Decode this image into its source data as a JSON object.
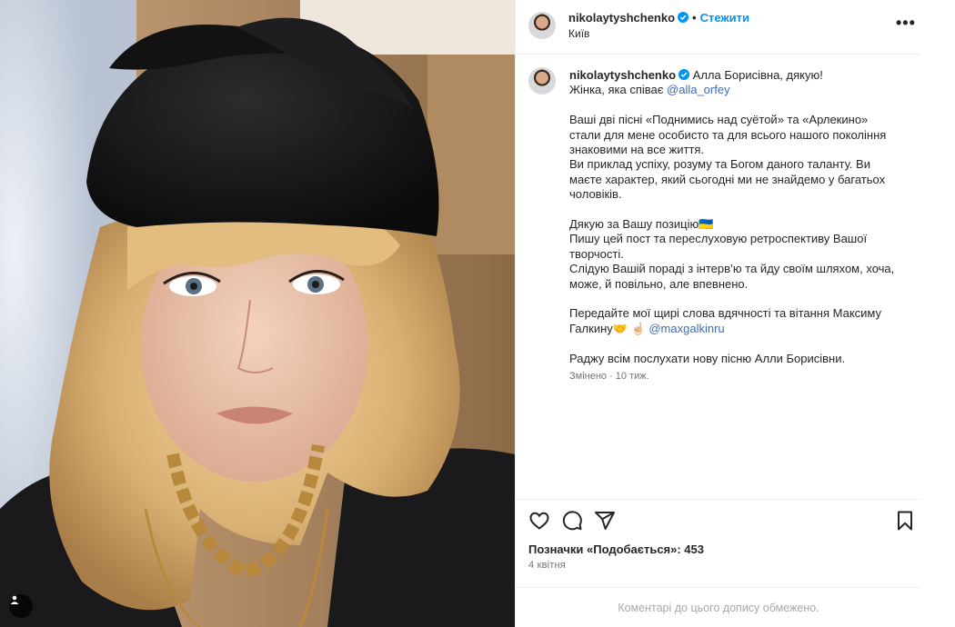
{
  "photo": {
    "alt_icon": "user-tag-icon"
  },
  "header": {
    "username": "nikolaytyshchenko",
    "separator": "•",
    "follow_label": "Стежити",
    "location": "Київ",
    "more_icon": "more-options-icon"
  },
  "caption": {
    "username": "nikolaytyshchenko",
    "first_line": "Алла Борисівна, дякую!",
    "line2_text": "Жінка, яка співає ",
    "line2_mention": "@alla_orfey",
    "para1": [
      "Ваші дві пісні «Поднимись над суётой» та «Арлекино»",
      "стали для мене особисто та для всього нашого покоління",
      "знаковими на все життя.",
      "Ви приклад успіху, розуму та Богом даного таланту. Ви",
      "маєте характер, який сьогодні ми не знайдемо у багатьох",
      "чоловіків."
    ],
    "para2": [
      "Дякую за Вашу позицію🇺🇦",
      "Пишу цей пост та переслуховую ретроспективу Вашої",
      "творчості.",
      "Слідую Вашій пораді з інтерв’ю та йду своїм шляхом, хоча,",
      "може, й повільно, але впевнено."
    ],
    "para3_line1": "Передайте мої щирі слова вдячності та вітання Максиму",
    "para3_line2_text": "Галкину🤝 ☝🏻 ",
    "para3_mention": "@maxgalkinru",
    "para4": "Раджу всім послухати нову пісню Алли Борисівни.",
    "meta": "Змінено · 10 тиж."
  },
  "actions": {
    "like_icon": "heart-icon",
    "comment_icon": "comment-icon",
    "share_icon": "share-icon",
    "save_icon": "bookmark-icon"
  },
  "likes_text": "Позначки «Подобається»: 453",
  "date": "4 квітня",
  "comments_limited": "Коментарі до цього допису обмежено.",
  "colors": {
    "accent": "#0095f6",
    "mention": "#385a97",
    "muted": "#737373"
  }
}
